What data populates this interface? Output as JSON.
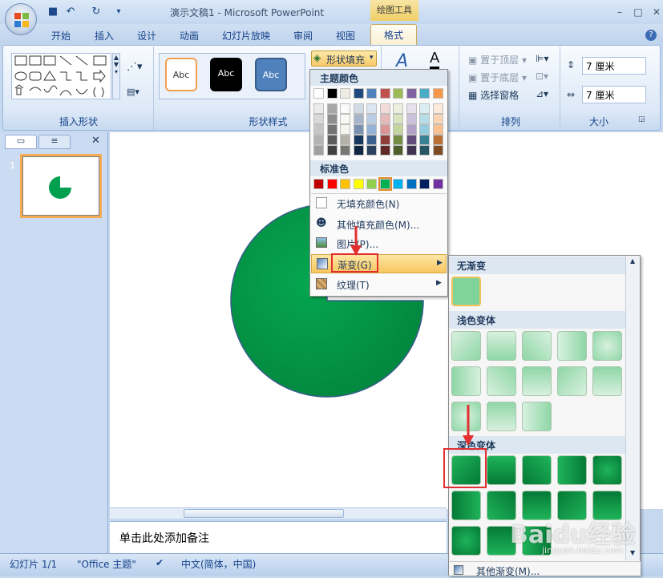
{
  "app": {
    "title": "演示文稿1 - Microsoft PowerPoint",
    "contextual_tab_header": "绘图工具"
  },
  "tabs": [
    {
      "label": "开始"
    },
    {
      "label": "插入"
    },
    {
      "label": "设计"
    },
    {
      "label": "动画"
    },
    {
      "label": "幻灯片放映"
    },
    {
      "label": "审阅"
    },
    {
      "label": "视图"
    },
    {
      "label": "格式"
    }
  ],
  "ribbon": {
    "insert_shapes": {
      "label": "插入形状"
    },
    "shape_styles": {
      "label": "形状样式",
      "presets": [
        "Abc",
        "Abc",
        "Abc"
      ],
      "fill_button": "形状填充"
    },
    "arrange": {
      "label": "排列",
      "bring_front": "置于顶层",
      "send_back": "置于底层",
      "selection_pane": "选择窗格"
    },
    "size": {
      "label": "大小",
      "height": "7 厘米",
      "width": "7 厘米"
    }
  },
  "fill_menu": {
    "theme_colors_header": "主题颜色",
    "standard_colors_header": "标准色",
    "theme_colors": [
      "#ffffff",
      "#000000",
      "#eeece1",
      "#1f497d",
      "#4f81bd",
      "#c0504d",
      "#9bbb59",
      "#8064a2",
      "#4bacc6",
      "#f79646"
    ],
    "standard_colors": [
      "#c00000",
      "#ff0000",
      "#ffc000",
      "#ffff00",
      "#92d050",
      "#00b050",
      "#00b0f0",
      "#0070c0",
      "#002060",
      "#7030a0"
    ],
    "items": [
      {
        "label": "无填充颜色(N)"
      },
      {
        "label": "其他填充颜色(M)..."
      },
      {
        "label": "图片(P)..."
      },
      {
        "label": "渐变(G)"
      },
      {
        "label": "纹理(T)"
      }
    ]
  },
  "gradient_panel": {
    "no_gradient": "无渐变",
    "light_variations": "浅色变体",
    "dark_variations": "深色变体",
    "more": "其他渐变(M)..."
  },
  "notes": {
    "placeholder": "单击此处添加备注"
  },
  "status": {
    "slide": "幻灯片 1/1",
    "theme": "\"Office 主题\"",
    "language": "中文(简体，中国)"
  },
  "slide_number": "1",
  "watermark": {
    "text": "Baidu经验",
    "sub": "jingyan.baidu.com"
  },
  "colors": {
    "accent_green": "#00a050",
    "highlight": "#e23030"
  }
}
